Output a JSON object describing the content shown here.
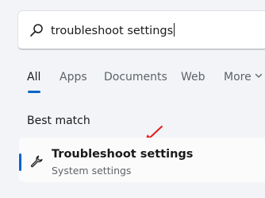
{
  "search": {
    "query": "troubleshoot settings"
  },
  "tabs": [
    {
      "label": "All"
    },
    {
      "label": "Apps"
    },
    {
      "label": "Documents"
    },
    {
      "label": "Web"
    },
    {
      "label": "More"
    }
  ],
  "best_match": {
    "heading": "Best match",
    "title": "Troubleshoot settings",
    "subtitle": "System settings"
  },
  "colors": {
    "accent": "#0a64c8",
    "annotation_arrow": "#e81b1b",
    "background": "#f2f4f7"
  },
  "icons": {
    "search": "search-icon",
    "more": "chevron-down-icon",
    "result": "wrench-icon",
    "annotation": "red-arrow-annotation"
  }
}
